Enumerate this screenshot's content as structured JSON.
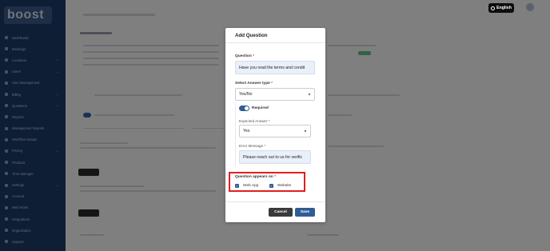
{
  "app": {
    "logo_text": "boost"
  },
  "header": {
    "language_label": "English"
  },
  "sidebar": {
    "items": [
      {
        "label": "Dashboard"
      },
      {
        "label": "Bookings"
      },
      {
        "label": "Locations"
      },
      {
        "label": "Users"
      },
      {
        "label": "User Management"
      },
      {
        "label": "Billing"
      },
      {
        "label": "Questions"
      },
      {
        "label": "Reports"
      },
      {
        "label": "Management Reports"
      },
      {
        "label": "Workflow Setups"
      },
      {
        "label": "Pricing"
      },
      {
        "label": "Products"
      },
      {
        "label": "Time Manager"
      },
      {
        "label": "Settings"
      },
      {
        "label": "Account"
      },
      {
        "label": "Web Kiosk"
      },
      {
        "label": "Integrations"
      },
      {
        "label": "Organization"
      },
      {
        "label": "Support"
      }
    ]
  },
  "modal": {
    "title": "Add Question",
    "question_label": "Question",
    "required_mark": "*",
    "question_value": "Have you read the terms and condit",
    "answer_type_label": "Select Answer type",
    "answer_type_value": "Yes/No",
    "required_toggle_label": "Required",
    "expected_answer_label": "Expected Answer",
    "expected_answer_value": "Yes",
    "error_message_label": "Error Message",
    "error_message_value": "Please reach out to us for verific",
    "appears_on_label": "Question appears on",
    "options": [
      {
        "label": "Web App",
        "checked": true
      },
      {
        "label": "Website",
        "checked": true
      }
    ],
    "cancel_label": "Cancel",
    "save_label": "Save"
  },
  "colors": {
    "sidebar": "#1b3c6a",
    "primary": "#2f5d94",
    "highlight_border": "#e02020"
  }
}
